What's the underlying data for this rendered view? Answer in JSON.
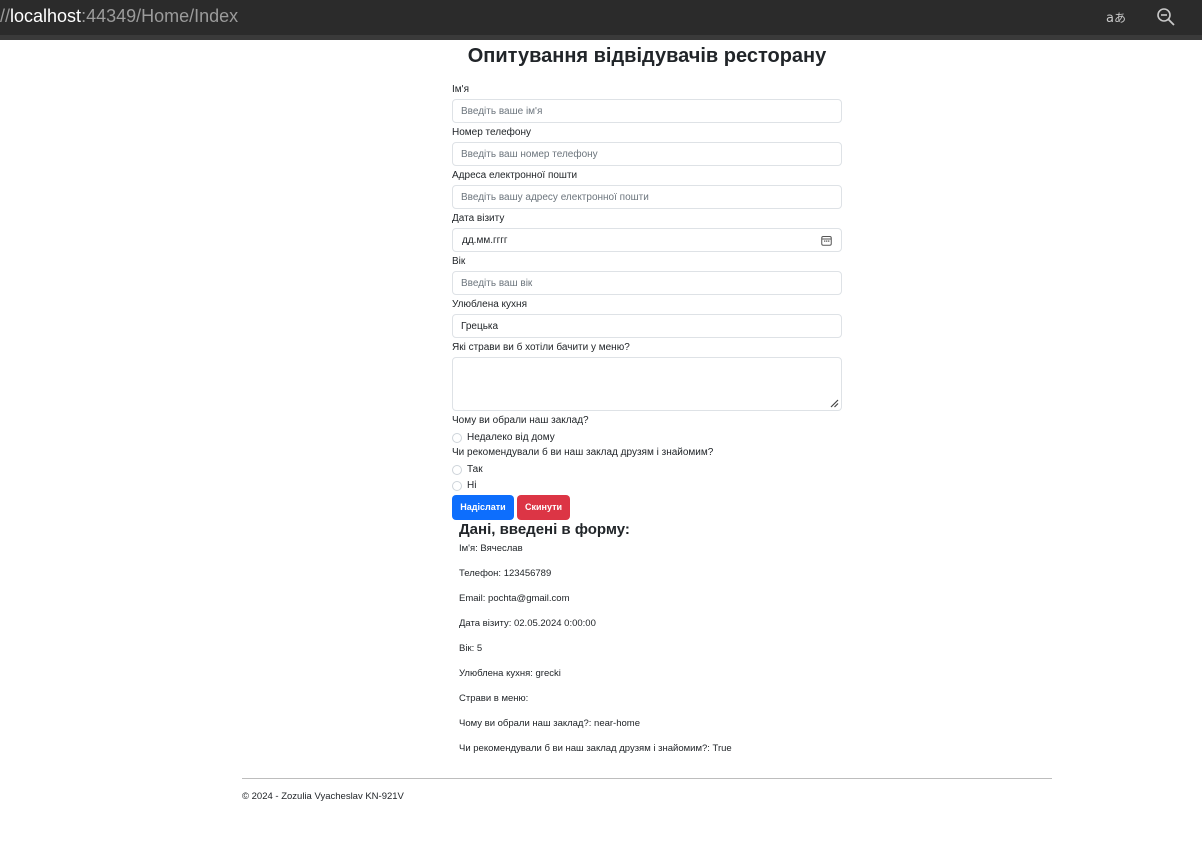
{
  "browser": {
    "url_prefix": "//",
    "url_host": "localhost",
    "url_rest": ":44349/Home/Index",
    "icons": [
      "translate-icon",
      "zoom-out-icon"
    ]
  },
  "page": {
    "title": "Опитування відвідувачів ресторану"
  },
  "form": {
    "name_label": "Ім'я",
    "name_placeholder": "Введіть ваше ім'я",
    "phone_label": "Номер телефону",
    "phone_placeholder": "Введіть ваш номер телефону",
    "email_label": "Адреса електронної пошти",
    "email_placeholder": "Введіть вашу адресу електронної пошти",
    "date_label": "Дата візиту",
    "date_value": "дд.мм.гггг",
    "age_label": "Вік",
    "age_placeholder": "Введіть ваш вік",
    "cuisine_label": "Улюблена кухня",
    "cuisine_value": "Грецька",
    "dishes_label": "Які страви ви б хотіли бачити у меню?",
    "reason_label": "Чому ви обрали наш заклад?",
    "reason_option": "Недалеко від дому",
    "recommend_label": "Чи рекомендували б ви наш заклад друзям і знайомим?",
    "recommend_yes": "Так",
    "recommend_no": "Ні",
    "submit_label": "Надіслати",
    "reset_label": "Скинути"
  },
  "results": {
    "heading": "Дані, введені в форму:",
    "lines": [
      "Ім'я: Вячеслав",
      "Телефон: 123456789",
      "Email: pochta@gmail.com",
      "Дата візиту: 02.05.2024 0:00:00",
      "Вік: 5",
      "Улюблена кухня: grecki",
      "Страви в меню:",
      "Чому ви обрали наш заклад?: near-home",
      "Чи рекомендували б ви наш заклад друзям і знайомим?: True"
    ]
  },
  "footer": {
    "text": "© 2024 - Zozulia Vyacheslav KN-921V"
  },
  "colors": {
    "primary": "#0d6efd",
    "danger": "#dc3545",
    "topbar": "#2b2b2b"
  }
}
